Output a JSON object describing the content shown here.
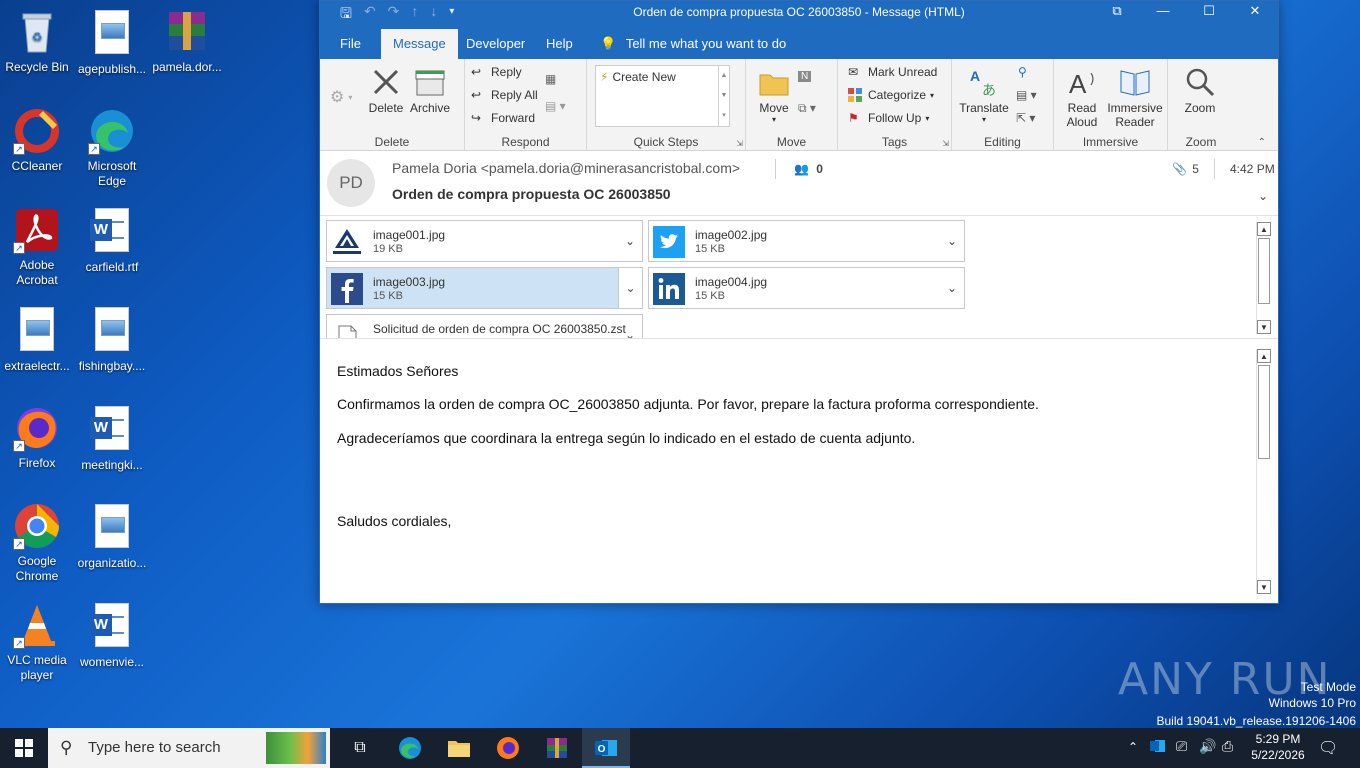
{
  "desktop": {
    "icons": [
      {
        "label": "Recycle Bin"
      },
      {
        "label": "agepublish..."
      },
      {
        "label": "pamela.dor..."
      },
      {
        "label": "CCleaner"
      },
      {
        "label": "Microsoft Edge"
      },
      {
        "label": "Adobe Acrobat"
      },
      {
        "label": "carfield.rtf"
      },
      {
        "label": "extraelectr..."
      },
      {
        "label": "fishingbay...."
      },
      {
        "label": "Firefox"
      },
      {
        "label": "meetingki..."
      },
      {
        "label": "Google Chrome"
      },
      {
        "label": "organizatio..."
      },
      {
        "label": "VLC media player"
      },
      {
        "label": "womenvie..."
      }
    ]
  },
  "window": {
    "title": "Orden de compra propuesta OC 26003850  -  Message (HTML)",
    "tabs": [
      "File",
      "Message",
      "Developer",
      "Help"
    ],
    "tell_me": "Tell me what you want to do",
    "ribbon": {
      "delete": {
        "group": "Delete",
        "delete_label": "Delete",
        "archive_label": "Archive"
      },
      "respond": {
        "group": "Respond",
        "reply": "Reply",
        "reply_all": "Reply All",
        "forward": "Forward"
      },
      "quicksteps": {
        "group": "Quick Steps",
        "create_new": "Create New"
      },
      "move": {
        "group": "Move",
        "move_label": "Move"
      },
      "tags": {
        "group": "Tags",
        "mark_unread": "Mark Unread",
        "categorize": "Categorize",
        "follow_up": "Follow Up"
      },
      "editing": {
        "group": "Editing",
        "translate": "Translate"
      },
      "immersive": {
        "group": "Immersive",
        "read_aloud": "Read Aloud",
        "immersive_reader": "Immersive Reader"
      },
      "zoom": {
        "group": "Zoom",
        "zoom_label": "Zoom"
      }
    },
    "message": {
      "avatar_initials": "PD",
      "sender": "Pamela Doria <pamela.doria@minerasancristobal.com>",
      "subject": "Orden de compra propuesta OC 26003850",
      "people_count": "0",
      "attachment_count": "5",
      "time": "4:42 PM",
      "attachments": [
        {
          "name": "image001.jpg",
          "size": "19 KB"
        },
        {
          "name": "image002.jpg",
          "size": "15 KB"
        },
        {
          "name": "image003.jpg",
          "size": "15 KB"
        },
        {
          "name": "image004.jpg",
          "size": "15 KB"
        },
        {
          "name": "Solicitud de orden de compra OC 26003850.zst",
          "size": ""
        }
      ],
      "body": {
        "greeting": "Estimados Señores",
        "line1": "Confirmamos la orden de compra OC_26003850 adjunta. Por favor, prepare la factura proforma correspondiente.",
        "line2": "Agradeceríamos que coordinara la entrega según lo indicado en el estado de cuenta adjunto.",
        "closing": "Saludos cordiales,"
      }
    }
  },
  "taskbar": {
    "search_placeholder": "Type here to search",
    "time": "5:29 PM",
    "date": "5/22/2026"
  },
  "watermark": {
    "brand": "ANY RUN",
    "line1": "Test Mode",
    "line2": "Windows 10 Pro",
    "line3": "Build 19041.vb_release.191206-1406"
  },
  "colors": {
    "outlook_blue": "#1f6bc0",
    "ribbon_bg": "#f3f3f3",
    "selected_attachment": "#cde3f5",
    "taskbar": "#16202e"
  }
}
